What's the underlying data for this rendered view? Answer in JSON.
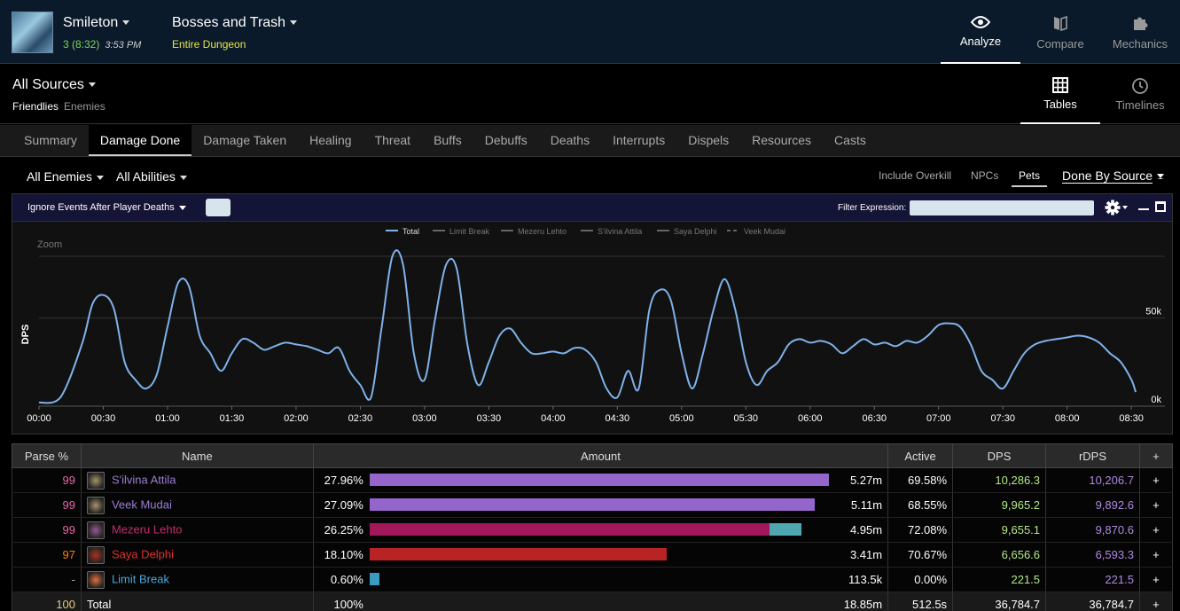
{
  "header": {
    "character": "Smileton",
    "pulls": "3 (8:32)",
    "time": "3:53 PM",
    "fight": "Bosses and Trash",
    "fight_sub": "Entire Dungeon",
    "nav": [
      {
        "label": "Analyze",
        "icon": "eye-icon",
        "active": true
      },
      {
        "label": "Compare",
        "icon": "compare-icon",
        "active": false
      },
      {
        "label": "Mechanics",
        "icon": "puzzle-icon",
        "active": false
      }
    ]
  },
  "sources": {
    "title": "All Sources",
    "friendlies": "Friendlies",
    "enemies": "Enemies",
    "views": [
      {
        "label": "Tables",
        "icon": "grid-icon",
        "active": true
      },
      {
        "label": "Timelines",
        "icon": "clock-icon",
        "active": false
      }
    ]
  },
  "tabs": [
    "Summary",
    "Damage Done",
    "Damage Taken",
    "Healing",
    "Threat",
    "Buffs",
    "Debuffs",
    "Deaths",
    "Interrupts",
    "Dispels",
    "Resources",
    "Casts"
  ],
  "active_tab": "Damage Done",
  "filters": {
    "enemies": "All Enemies",
    "abilities": "All Abilities",
    "include_overkill": "Include Overkill",
    "npcs": "NPCs",
    "pets": "Pets",
    "done_by": "Done By Source"
  },
  "panel": {
    "ignore": "Ignore Events After Player Deaths",
    "filter_label": "Filter Expression:"
  },
  "chart_data": {
    "type": "line",
    "legend": [
      "Total",
      "Limit Break",
      "Mezeru Lehto",
      "S'ilvina Attila",
      "Saya Delphi",
      "Veek Mudai"
    ],
    "zoom_label": "Zoom",
    "ylabel": "DPS",
    "y_ticks": [
      "0k",
      "50k"
    ],
    "ylim": [
      0,
      85000
    ],
    "x_ticks": [
      "00:00",
      "00:30",
      "01:00",
      "01:30",
      "02:00",
      "02:30",
      "03:00",
      "03:30",
      "04:00",
      "04:30",
      "05:00",
      "05:30",
      "06:00",
      "06:30",
      "07:00",
      "07:30",
      "08:00",
      "08:30"
    ],
    "series": [
      {
        "name": "Total",
        "color": "#7fb2ea",
        "x": [
          0,
          10,
          20,
          25,
          30,
          35,
          40,
          45,
          50,
          55,
          60,
          65,
          70,
          75,
          80,
          85,
          90,
          95,
          100,
          105,
          110,
          115,
          120,
          125,
          130,
          135,
          140,
          145,
          150,
          155,
          160,
          165,
          170,
          175,
          180,
          185,
          190,
          195,
          200,
          205,
          210,
          215,
          220,
          225,
          230,
          235,
          240,
          245,
          250,
          255,
          260,
          265,
          270,
          275,
          280,
          285,
          290,
          295,
          300,
          305,
          310,
          315,
          320,
          325,
          330,
          335,
          340,
          345,
          350,
          355,
          360,
          365,
          370,
          375,
          380,
          385,
          390,
          395,
          400,
          405,
          410,
          415,
          420,
          425,
          430,
          435,
          440,
          445,
          450,
          455,
          460,
          465,
          470,
          475,
          480,
          485,
          490,
          495,
          500,
          505,
          510,
          512
        ],
        "y": [
          2000,
          5000,
          35000,
          58000,
          63000,
          55000,
          25000,
          15000,
          10000,
          18000,
          45000,
          70000,
          68000,
          40000,
          30000,
          20000,
          30000,
          38000,
          36000,
          32000,
          34000,
          36000,
          35000,
          34000,
          32000,
          30000,
          33000,
          20000,
          12000,
          5000,
          45000,
          85000,
          80000,
          30000,
          15000,
          50000,
          80000,
          78000,
          35000,
          12000,
          25000,
          40000,
          44000,
          36000,
          30000,
          30000,
          31000,
          30000,
          33000,
          32000,
          25000,
          10000,
          5000,
          20000,
          10000,
          55000,
          66000,
          60000,
          30000,
          10000,
          30000,
          55000,
          72000,
          55000,
          25000,
          12000,
          20000,
          25000,
          35000,
          38000,
          36000,
          37000,
          35000,
          30000,
          34000,
          38000,
          35000,
          36000,
          34000,
          37000,
          36000,
          40000,
          46000,
          47000,
          45000,
          35000,
          20000,
          15000,
          10000,
          20000,
          30000,
          35000,
          37000,
          38000,
          39000,
          40000,
          39000,
          36000,
          30000,
          25000,
          15000,
          8000
        ]
      }
    ]
  },
  "table": {
    "headers": [
      "Parse %",
      "Name",
      "Amount",
      "Active",
      "DPS",
      "rDPS",
      "+"
    ],
    "rows": [
      {
        "parse": "99",
        "parse_color": "#e268a8",
        "name": "S'ilvina Attila",
        "name_color": "#9b7fd4",
        "job_icon": "bard-icon",
        "job_color": "#a6936a",
        "pct": "27.96%",
        "frac": 0.9958,
        "bar_color": "#9466cc",
        "pet_frac": 0,
        "amount": "5.27m",
        "active": "69.58%",
        "dps": "10,286.3",
        "dps_color": "#b4e886",
        "rdps": "10,206.7",
        "rdps_color": "#b08ae0"
      },
      {
        "parse": "99",
        "parse_color": "#e268a8",
        "name": "Veek Mudai",
        "name_color": "#9b7fd4",
        "job_icon": "bard-icon",
        "job_color": "#a6936a",
        "pct": "27.09%",
        "frac": 0.9648,
        "bar_color": "#9466cc",
        "pet_frac": 0,
        "amount": "5.11m",
        "active": "68.55%",
        "dps": "9,965.2",
        "dps_color": "#b4e886",
        "rdps": "9,892.6",
        "rdps_color": "#b08ae0"
      },
      {
        "parse": "99",
        "parse_color": "#e268a8",
        "name": "Mezeru Lehto",
        "name_color": "#c0306a",
        "job_icon": "reaper-icon",
        "job_color": "#965a90",
        "pct": "26.25%",
        "frac": 0.8669,
        "bar_color": "#a0185a",
        "pet_frac": 0.0698,
        "pet_color": "#4fa8b0",
        "amount": "4.95m",
        "active": "72.08%",
        "dps": "9,655.1",
        "dps_color": "#b4e886",
        "rdps": "9,870.6",
        "rdps_color": "#b08ae0"
      },
      {
        "parse": "97",
        "parse_color": "#ff8000",
        "name": "Saya Delphi",
        "name_color": "#e03030",
        "job_icon": "warrior-icon",
        "job_color": "#b03020",
        "pct": "18.10%",
        "frac": 0.6448,
        "bar_color": "#b82424",
        "pet_frac": 0,
        "amount": "3.41m",
        "active": "70.67%",
        "dps": "6,656.6",
        "dps_color": "#b4e886",
        "rdps": "6,593.3",
        "rdps_color": "#b08ae0"
      },
      {
        "parse": "-",
        "parse_color": "#aaaaaa",
        "name": "Limit Break",
        "name_color": "#4aa8d8",
        "job_icon": "limit-break-icon",
        "job_color": "#e0703a",
        "pct": "0.60%",
        "frac": 0.0214,
        "bar_color": "#3a9ac0",
        "pet_frac": 0,
        "amount": "113.5k",
        "active": "0.00%",
        "dps": "221.5",
        "dps_color": "#b4e886",
        "rdps": "221.5",
        "rdps_color": "#b08ae0"
      }
    ],
    "total": {
      "parse": "100",
      "name": "Total",
      "pct": "100%",
      "amount": "18.85m",
      "active": "512.5s",
      "dps": "36,784.7",
      "rdps": "36,784.7"
    }
  }
}
